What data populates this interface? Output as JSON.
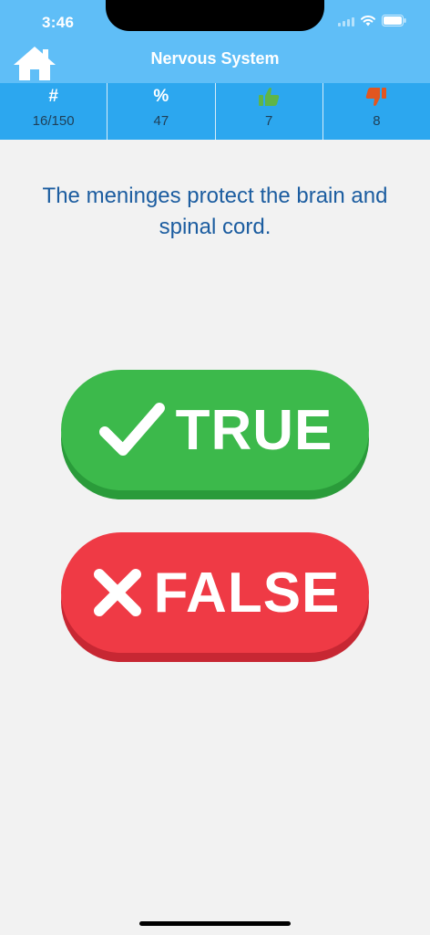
{
  "status_bar": {
    "time": "3:46"
  },
  "header": {
    "title": "Nervous System"
  },
  "stats": [
    {
      "symbol": "#",
      "value": "16/150"
    },
    {
      "symbol": "%",
      "value": "47"
    },
    {
      "symbol": "thumbs-up-icon",
      "value": "7"
    },
    {
      "symbol": "thumbs-down-icon",
      "value": "8"
    }
  ],
  "question": {
    "text": "The meninges protect the brain and spinal cord."
  },
  "answers": {
    "true_label": "TRUE",
    "false_label": "FALSE"
  },
  "colors": {
    "header": "#5fbef7",
    "stats_bar": "#2ca7ef",
    "question_text": "#1c5da0",
    "true_button": "#3cb94b",
    "false_button": "#ef3a45",
    "thumbs_up": "#5fb548",
    "thumbs_down": "#e2561f"
  }
}
